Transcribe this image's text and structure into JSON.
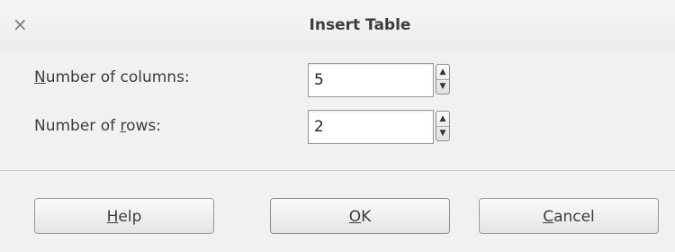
{
  "window": {
    "title": "Insert Table",
    "close_glyph": "×"
  },
  "fields": {
    "columns": {
      "label_mnemonic": "N",
      "label_rest": "umber of columns:",
      "value": "5"
    },
    "rows": {
      "label_pre": "Number of ",
      "label_mnemonic": "r",
      "label_rest": "ows:",
      "value": "2"
    }
  },
  "buttons": {
    "help": {
      "mnemonic": "H",
      "rest": "elp"
    },
    "ok": {
      "mnemonic": "O",
      "rest": "K"
    },
    "cancel": {
      "mnemonic": "C",
      "rest": "ancel"
    }
  }
}
